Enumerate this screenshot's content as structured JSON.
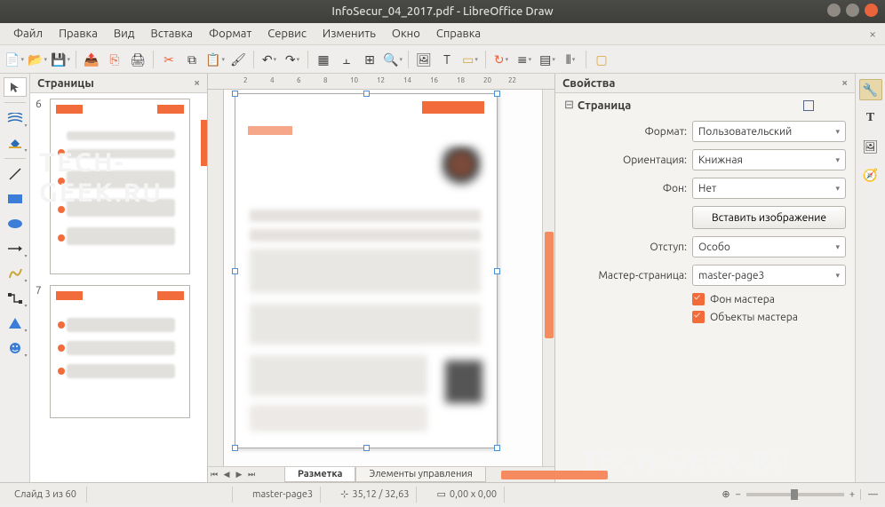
{
  "window": {
    "title": "InfoSecur_04_2017.pdf - LibreOffice Draw"
  },
  "menu": {
    "items": [
      "Файл",
      "Правка",
      "Вид",
      "Вставка",
      "Формат",
      "Сервис",
      "Изменить",
      "Окно",
      "Справка"
    ]
  },
  "pages_panel": {
    "title": "Страницы",
    "pages": [
      {
        "num": "6"
      },
      {
        "num": "7"
      }
    ]
  },
  "canvas": {
    "ruler_marks": [
      "2",
      "4",
      "6",
      "8",
      "10",
      "12",
      "14",
      "16",
      "18",
      "20",
      "22"
    ],
    "tabs": {
      "active": "Разметка",
      "other": "Элементы управления"
    }
  },
  "properties": {
    "title": "Свойства",
    "section": "Страница",
    "rows": {
      "format_label": "Формат:",
      "format_value": "Пользовательский",
      "orient_label": "Ориентация:",
      "orient_value": "Книжная",
      "bg_label": "Фон:",
      "bg_value": "Нет",
      "insert_image_btn": "Вставить изображение",
      "margin_label": "Отступ:",
      "margin_value": "Особо",
      "master_label": "Мастер-страница:",
      "master_value": "master-page3",
      "chk_master_bg": "Фон мастера",
      "chk_master_obj": "Объекты мастера"
    }
  },
  "status": {
    "slide": "Слайд 3 из 60",
    "master": "master-page3",
    "pos": "35,12 / 32,63",
    "size": "0,00 x 0,00",
    "zoom_dash": "—"
  },
  "watermark": "TECH-GEEK.RU"
}
